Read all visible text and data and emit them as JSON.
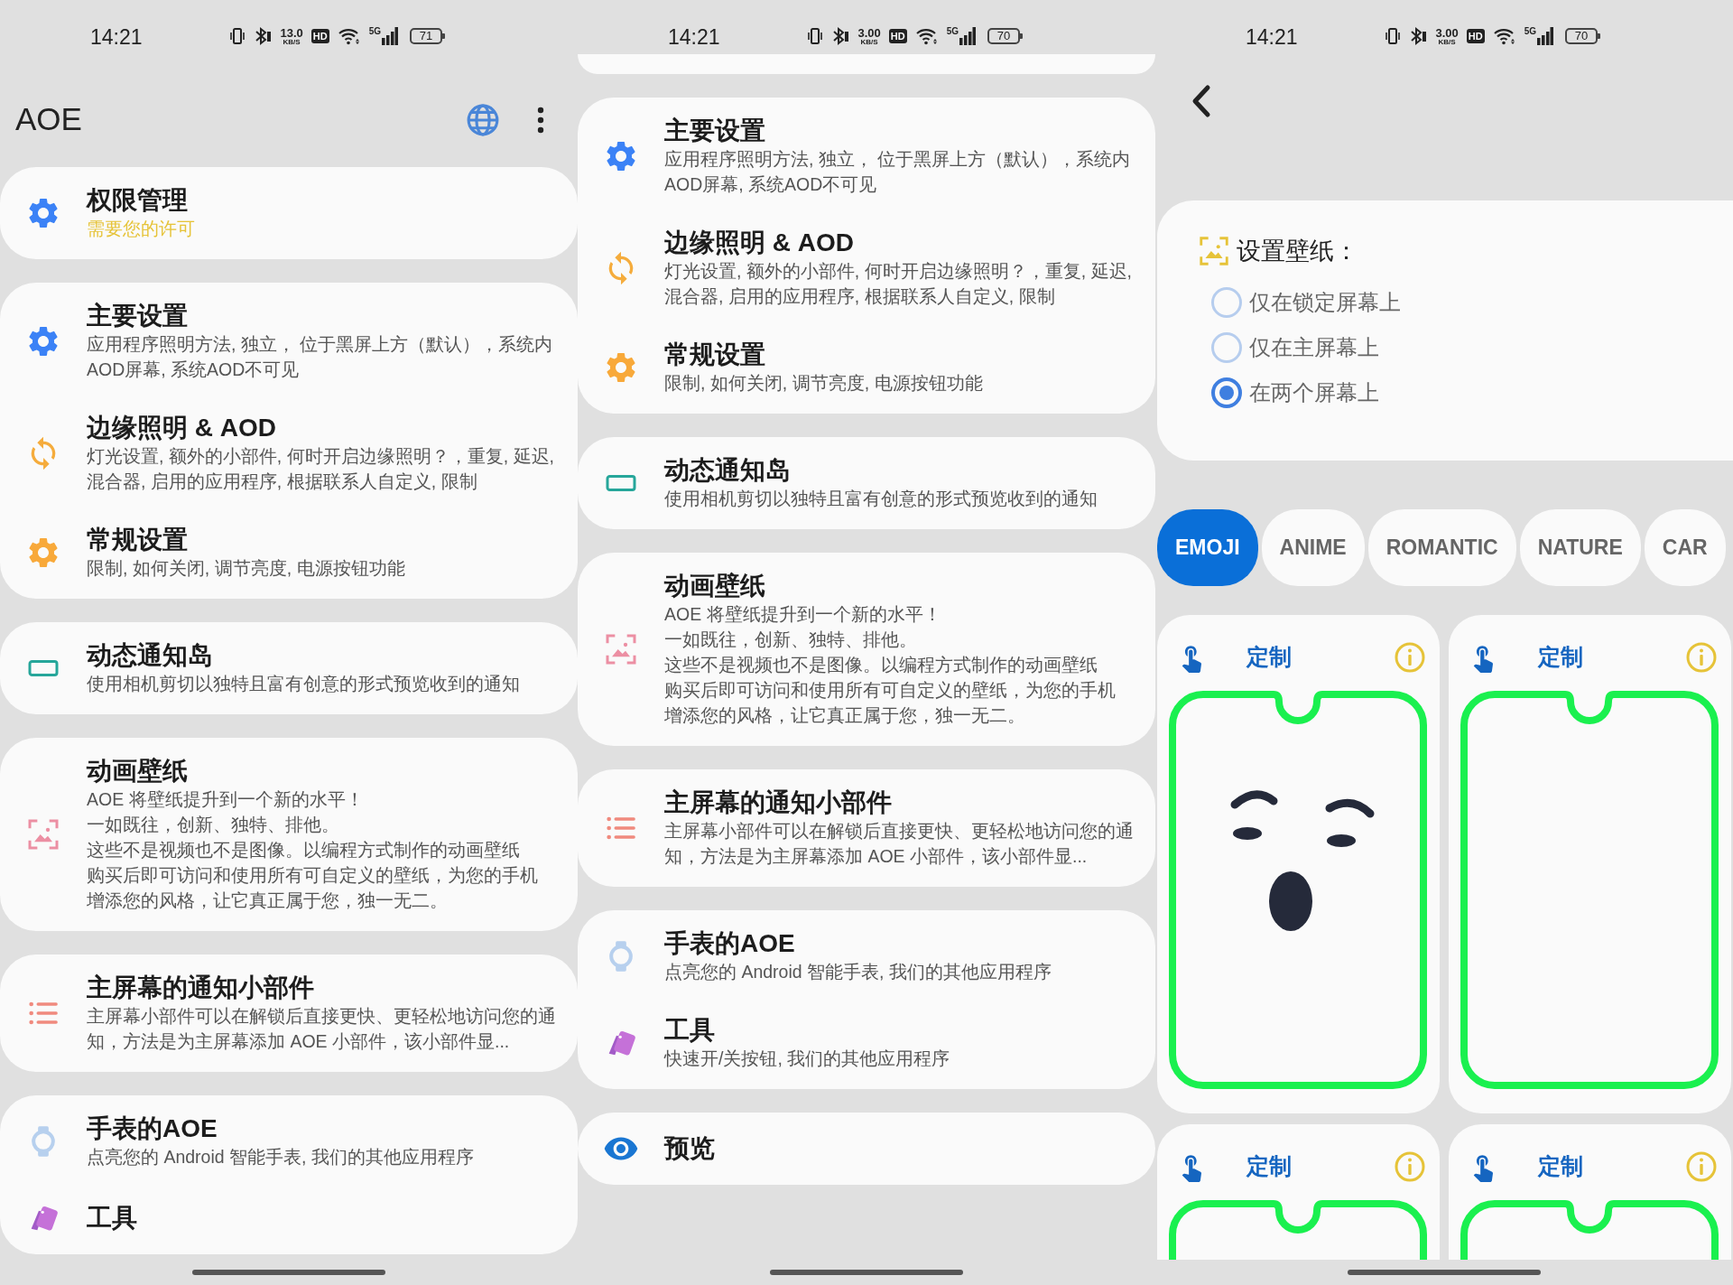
{
  "panels": [
    {
      "kind": "home",
      "status_bar": {
        "time": "14:21",
        "speed_value": "13.0",
        "speed_unit": "KB/S",
        "hd": "HD",
        "network": "5G",
        "battery": "71"
      },
      "app_bar": {
        "title": "AOE"
      },
      "cut_top": false,
      "cards": [
        {
          "items": [
            {
              "kind": "gear_blue",
              "title": "权限管理",
              "note": "需要您的许可"
            }
          ]
        },
        {
          "items": [
            {
              "kind": "gear_blue",
              "title": "主要设置",
              "subtitle": "应用程序照明方法, 独立， 位于黑屏上方（默认），系统内AOD屏幕, 系统AOD不可见"
            },
            {
              "kind": "sync",
              "title": "边缘照明 & AOD",
              "subtitle": "灯光设置, 额外的小部件, 何时开启边缘照明？，重复, 延迟, 混合器, 启用的应用程序, 根据联系人自定义, 限制"
            },
            {
              "kind": "gear_orange",
              "title": "常规设置",
              "subtitle": "限制, 如何关闭, 调节亮度, 电源按钮功能"
            }
          ]
        },
        {
          "items": [
            {
              "kind": "island",
              "title": "动态通知岛",
              "subtitle": "使用相机剪切以独特且富有创意的形式预览收到的通知"
            }
          ]
        },
        {
          "items": [
            {
              "kind": "wallpaper",
              "title": "动画壁纸",
              "lines": [
                "AOE 将壁纸提升到一个新的水平！",
                "一如既往，创新、独特、排他。",
                "这些不是视频也不是图像。以编程方式制作的动画壁纸",
                "购买后即可访问和使用所有可自定义的壁纸，为您的手机",
                "增添您的风格，让它真正属于您，独一无二。"
              ]
            }
          ]
        },
        {
          "items": [
            {
              "kind": "list",
              "title": "主屏幕的通知小部件",
              "subtitle": "主屏幕小部件可以在解锁后直接更快、更轻松地访问您的通知，方法是为主屏幕添加 AOE 小部件，该小部件显..."
            }
          ]
        },
        {
          "items": [
            {
              "kind": "watch",
              "title": "手表的AOE",
              "subtitle": "点亮您的 Android 智能手表, 我们的其他应用程序"
            },
            {
              "kind": "tools",
              "title": "工具"
            }
          ]
        }
      ]
    },
    {
      "kind": "home",
      "status_bar": {
        "time": "14:21",
        "speed_value": "3.00",
        "speed_unit": "KB/S",
        "hd": "HD",
        "network": "5G",
        "battery": "70"
      },
      "cut_top": true,
      "cards": [
        {
          "items": [
            {
              "kind": "gear_blue",
              "title": "主要设置",
              "subtitle": "应用程序照明方法, 独立， 位于黑屏上方（默认），系统内AOD屏幕, 系统AOD不可见"
            },
            {
              "kind": "sync",
              "title": "边缘照明 & AOD",
              "subtitle": "灯光设置, 额外的小部件, 何时开启边缘照明？，重复, 延迟, 混合器, 启用的应用程序, 根据联系人自定义, 限制"
            },
            {
              "kind": "gear_orange",
              "title": "常规设置",
              "subtitle": "限制, 如何关闭, 调节亮度, 电源按钮功能"
            }
          ]
        },
        {
          "items": [
            {
              "kind": "island",
              "title": "动态通知岛",
              "subtitle": "使用相机剪切以独特且富有创意的形式预览收到的通知"
            }
          ]
        },
        {
          "items": [
            {
              "kind": "wallpaper",
              "title": "动画壁纸",
              "lines": [
                "AOE 将壁纸提升到一个新的水平！",
                "一如既往，创新、独特、排他。",
                "这些不是视频也不是图像。以编程方式制作的动画壁纸",
                "购买后即可访问和使用所有可自定义的壁纸，为您的手机",
                "增添您的风格，让它真正属于您，独一无二。"
              ]
            }
          ]
        },
        {
          "items": [
            {
              "kind": "list",
              "title": "主屏幕的通知小部件",
              "subtitle": "主屏幕小部件可以在解锁后直接更快、更轻松地访问您的通知，方法是为主屏幕添加 AOE 小部件，该小部件显..."
            }
          ]
        },
        {
          "items": [
            {
              "kind": "watch",
              "title": "手表的AOE",
              "subtitle": "点亮您的 Android 智能手表, 我们的其他应用程序"
            },
            {
              "kind": "tools",
              "title": "工具",
              "subtitle": "快速开/关按钮, 我们的其他应用程序"
            }
          ]
        },
        {
          "items": [
            {
              "kind": "eye",
              "title": "预览"
            }
          ]
        }
      ]
    },
    {
      "kind": "wallpapers",
      "status_bar": {
        "time": "14:21",
        "speed_value": "3.00",
        "speed_unit": "KB/S",
        "hd": "HD",
        "network": "5G",
        "battery": "70"
      },
      "setting": {
        "title": "设置壁纸：",
        "options": [
          {
            "label": "仅在锁定屏幕上",
            "selected": false
          },
          {
            "label": "仅在主屏幕上",
            "selected": false
          },
          {
            "label": "在两个屏幕上",
            "selected": true
          }
        ]
      },
      "categories": [
        {
          "label": "EMOJI",
          "selected": true
        },
        {
          "label": "ANIME",
          "selected": false
        },
        {
          "label": "ROMANTIC",
          "selected": false
        },
        {
          "label": "NATURE",
          "selected": false
        },
        {
          "label": "CAR",
          "selected": false
        }
      ],
      "wallpapers": [
        {
          "label": "定制",
          "kind": "face"
        },
        {
          "label": "定制",
          "kind": "blank"
        },
        {
          "label": "定制",
          "kind": "blank"
        },
        {
          "label": "定制",
          "kind": "blank"
        }
      ]
    }
  ]
}
